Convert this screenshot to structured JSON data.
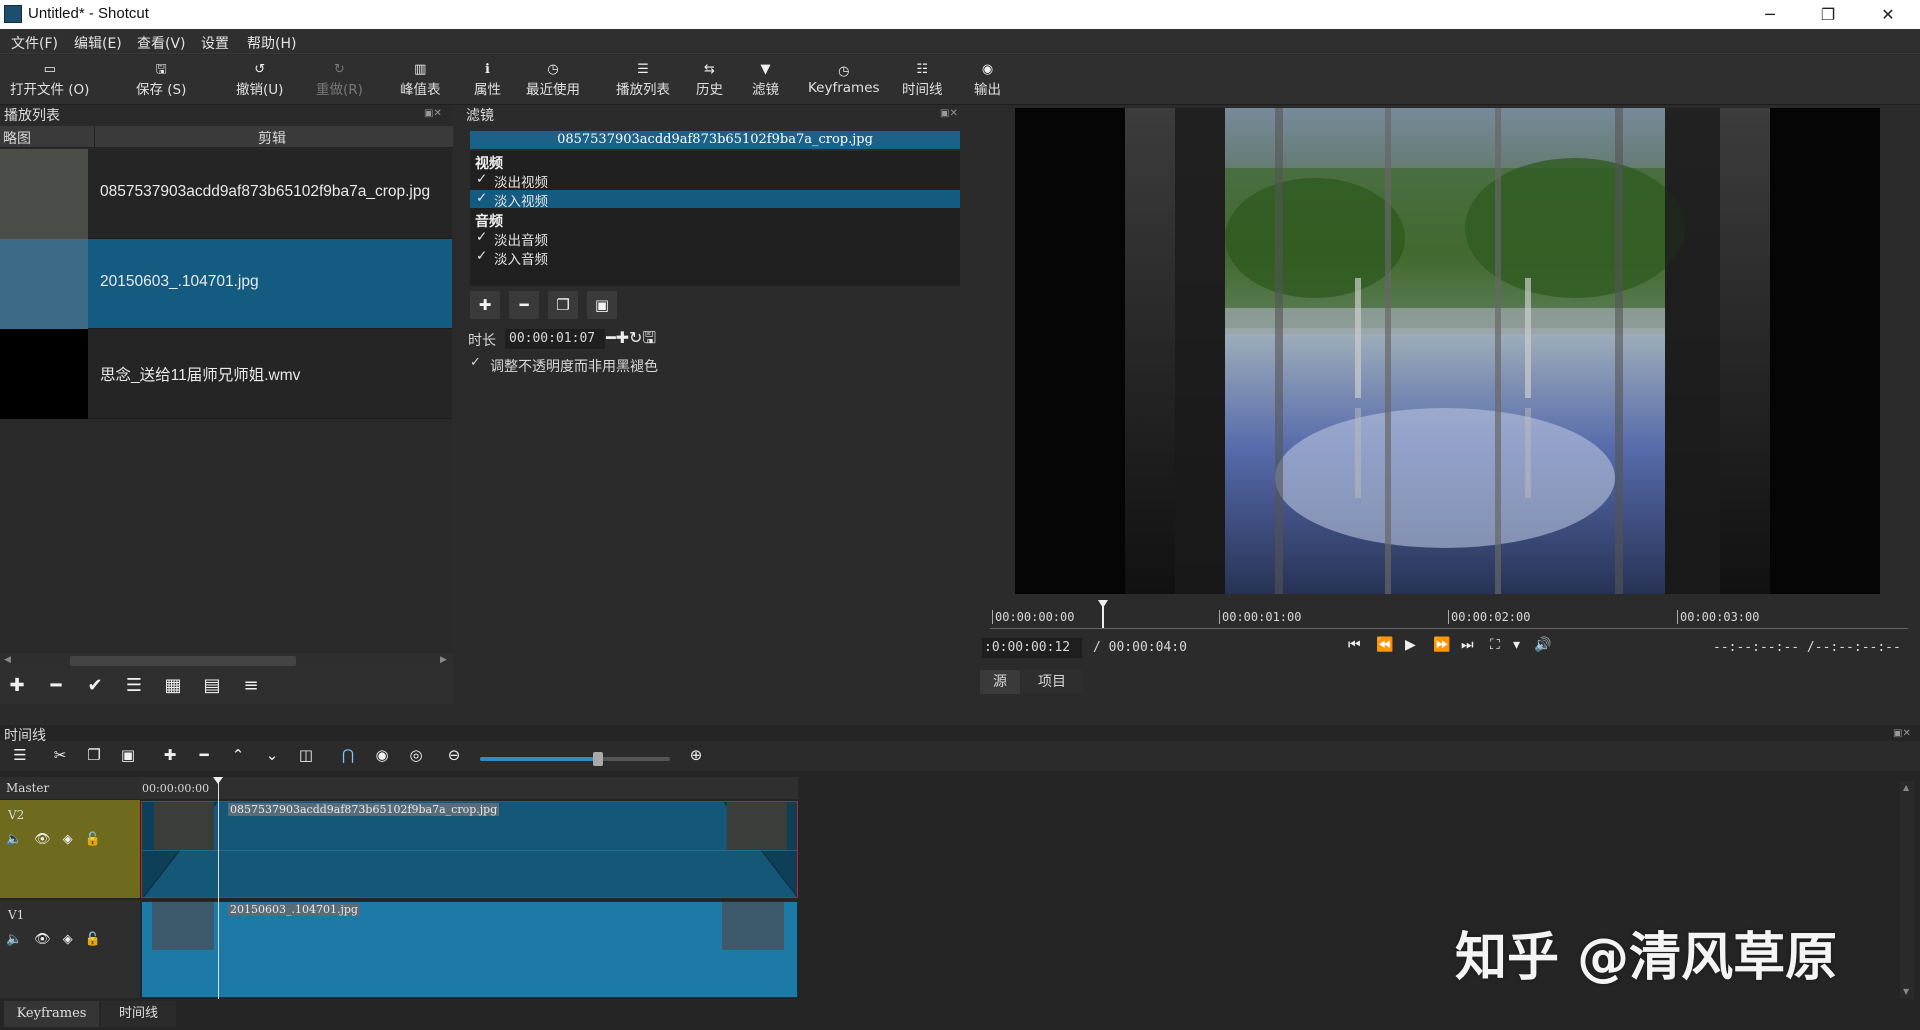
{
  "window": {
    "title": "Untitled* - Shotcut",
    "minimize": "─",
    "maximize": "❐",
    "close": "✕"
  },
  "menu": [
    "文件(F)",
    "编辑(E)",
    "查看(V)",
    "设置",
    "帮助(H)"
  ],
  "toolbar": [
    {
      "icon": "open-icon",
      "glyph": "▭",
      "label": "打开文件 (O)",
      "enabled": true
    },
    {
      "icon": "save-icon",
      "glyph": "🖫",
      "label": "保存 (S)",
      "enabled": true
    },
    {
      "icon": "undo-icon",
      "glyph": "↺",
      "label": "撤销(U)",
      "enabled": true
    },
    {
      "icon": "redo-icon",
      "glyph": "↻",
      "label": "重做(R)",
      "enabled": false
    },
    {
      "icon": "meter-icon",
      "glyph": "▥",
      "label": "峰值表",
      "enabled": true
    },
    {
      "icon": "info-icon",
      "glyph": "ℹ",
      "label": "属性",
      "enabled": true
    },
    {
      "icon": "clock-icon",
      "glyph": "◷",
      "label": "最近使用",
      "enabled": true
    },
    {
      "icon": "list-icon",
      "glyph": "☰",
      "label": "播放列表",
      "enabled": true
    },
    {
      "icon": "history-icon",
      "glyph": "⇆",
      "label": "历史",
      "enabled": true
    },
    {
      "icon": "filter-icon",
      "glyph": "▼",
      "label": "滤镜",
      "enabled": true
    },
    {
      "icon": "stopwatch-icon",
      "glyph": "◷",
      "label": "Keyframes",
      "enabled": true
    },
    {
      "icon": "timeline-icon",
      "glyph": "☷",
      "label": "时间线",
      "enabled": true
    },
    {
      "icon": "export-icon",
      "glyph": "◉",
      "label": "输出",
      "enabled": true
    }
  ],
  "playlist": {
    "title": "播放列表",
    "col_thumb": "略图",
    "col_clip": "剪辑",
    "items": [
      {
        "name": "0857537903acdd9af873b65102f9ba7a_crop.jpg",
        "selected": false
      },
      {
        "name": "20150603_.104701.jpg",
        "selected": true
      },
      {
        "name": "思念_送给11届师兄师姐.wmv",
        "selected": false
      }
    ],
    "buttons": [
      "add-icon",
      "remove-icon",
      "check-icon",
      "details-view-icon",
      "tiles-view-icon",
      "icons-view-icon",
      "menu-icon"
    ],
    "glyphs": [
      "✚",
      "━",
      "✔",
      "☰",
      "▦",
      "▤",
      "≡"
    ]
  },
  "filters": {
    "title": "滤镜",
    "clip_name": "0857537903acdd9af873b65102f9ba7a_crop.jpg",
    "categories": [
      {
        "name": "视频",
        "items": [
          {
            "label": "淡出视频",
            "checked": "✓",
            "selected": false
          },
          {
            "label": "淡入视频",
            "checked": "✓",
            "selected": true
          }
        ]
      },
      {
        "name": "音频",
        "items": [
          {
            "label": "淡出音频",
            "checked": "✓",
            "selected": false
          },
          {
            "label": "淡入音频",
            "checked": "✓",
            "selected": false
          }
        ]
      }
    ],
    "btn_glyphs": [
      "✚",
      "━",
      "❐",
      "▣"
    ],
    "duration_label": "时长",
    "duration_value": "00:00:01:07",
    "adjust_label": "调整不透明度而非用黑褪色",
    "adjust_check": "✓"
  },
  "player": {
    "ruler": [
      "00:00:00:00",
      "00:00:01:00",
      "00:00:02:00",
      "00:00:03:00"
    ],
    "position": ":0:00:00:12",
    "duration": "/ 00:00:04:0",
    "in_out": "--:--:--:-- /--:--:--:--",
    "tab_source": "源",
    "tab_project": "项目",
    "controls": [
      "⏮",
      "⏪",
      "▶",
      "⏩",
      "⏭",
      "⛶",
      "▾",
      "🔊"
    ]
  },
  "timeline": {
    "title": "时间线",
    "toolbar_glyphs": [
      "☰",
      "✂",
      "❐",
      "▣",
      "✚",
      "━",
      "⌃",
      "⌄",
      "◫",
      "⋂",
      "◉",
      "◎",
      "⊖",
      "⊕"
    ],
    "master": "Master",
    "ruler_start": "00:00:00:00",
    "tracks": [
      {
        "name": "V2",
        "clip": "0857537903acdd9af873b65102f9ba7a_crop.jpg"
      },
      {
        "name": "V1",
        "clip": "20150603_.104701.jpg"
      }
    ],
    "track_glyphs": [
      "🔈",
      "👁",
      "◈",
      "🔓"
    ],
    "zoom_level": 0.62
  },
  "bottom_tabs": [
    "Keyframes",
    "时间线"
  ],
  "watermark": "知乎 @清风草原",
  "colors": {
    "selection": "#135b80",
    "clip": "#1d7aa6",
    "track_head_selected": "#6e6a1e"
  }
}
